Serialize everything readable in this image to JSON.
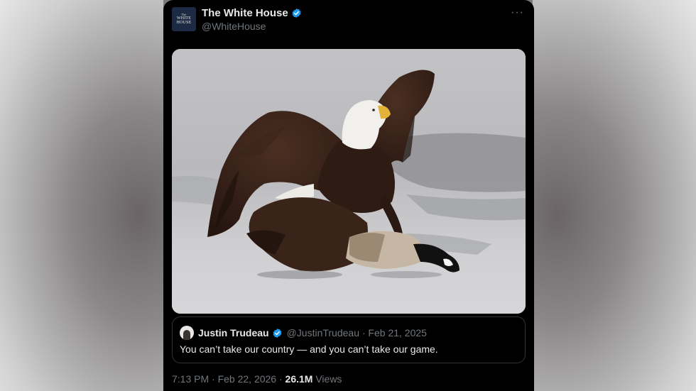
{
  "post": {
    "author": {
      "avatar_text": [
        "The",
        "WHITE",
        "HOUSE"
      ],
      "display_name": "The White House",
      "handle": "@WhiteHouse",
      "verified": true
    },
    "more_icon": "more-horizontal-icon",
    "more_glyph": "···",
    "quoted": {
      "author_name": "Justin Trudeau",
      "verified": true,
      "meta": "@JustinTrudeau · Feb 21, 2025",
      "text": "You can’t take our country — and you can’t take our game."
    },
    "footer": {
      "time_date": "7:13 PM · Feb 22, 2026 · ",
      "views_count": "26.1M",
      "views_label": " Views"
    }
  },
  "colors": {
    "card_bg": "#000000",
    "primary_text": "#e7e9ea",
    "secondary_text": "#71767b",
    "verified_blue": "#1d9bf0",
    "border": "#2f3336"
  }
}
